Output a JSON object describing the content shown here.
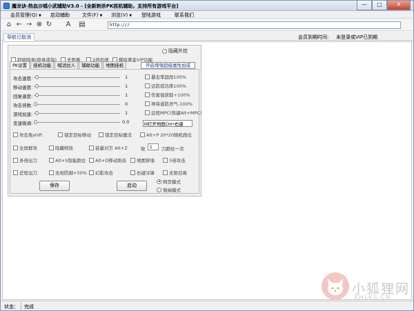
{
  "window": {
    "title": "魔龙诀-热血沙城小武辅助V3.0 - [全新刺杀PK挂机辅助，支持所有游戏平台]",
    "controls": {
      "minimize": "—",
      "maximize": "□",
      "close": "✕"
    }
  },
  "menu": [
    {
      "label": "会员管理(Q)",
      "has_arrow": true
    },
    {
      "label": "启动辅助",
      "has_arrow": false
    },
    {
      "label": "文件(F)",
      "has_arrow": true
    },
    {
      "label": "浏览(V)",
      "has_arrow": true
    },
    {
      "label": "登陆游戏",
      "has_arrow": false
    },
    {
      "label": "联系我们",
      "has_arrow": false
    }
  ],
  "toolbar": {
    "address_value": "http:///"
  },
  "tabstrip": {
    "page_tab": "导航已取消",
    "vip_label": "会员到期时间:",
    "vip_value": "未登录或VIP已到期"
  },
  "panel": {
    "top_options": [
      {
        "label": "超级隐身(隐身戒指)",
        "checked": false
      },
      {
        "label": "无限盾",
        "checked": false
      },
      {
        "label": "2倍加速",
        "checked": false
      },
      {
        "label": "模拟黄金VIP功能",
        "checked": false
      }
    ],
    "hide_plugin_label": "隐藏外挂",
    "tabs": [
      "PK设置",
      "挂机功能",
      "喊话拉人",
      "辅助功能",
      "地图挂机"
    ],
    "open_button": "开启增强超级属性加成",
    "sliders": [
      {
        "label": "攻击速度:",
        "value": "1"
      },
      {
        "label": "移动速度:",
        "value": "1"
      },
      {
        "label": "回复速度:",
        "value": "1"
      },
      {
        "label": "攻击倍数:",
        "value": "0"
      },
      {
        "label": "游戏加速:",
        "value": "1"
      },
      {
        "label": "变速微调:",
        "value": "0.0"
      }
    ],
    "right_options": [
      {
        "label": "暴击率超改100%",
        "checked": false
      },
      {
        "label": "远防成功率100%",
        "checked": false
      },
      {
        "label": "伤害值获取+100%",
        "checked": false
      },
      {
        "label": "神将道防灵气-100%",
        "checked": false
      },
      {
        "label": "远程MPC(热键Alt+MPC)",
        "checked": false
      }
    ],
    "hotkey_value": "M打开地图Ctrl+右键",
    "row1": [
      {
        "label": "攻击免shift",
        "checked": false
      },
      {
        "label": "锁定目标移动",
        "checked": false
      },
      {
        "label": "锁定目标魔法",
        "checked": false
      },
      {
        "label": "Alt+P 20*20随机跑位",
        "checked": false
      }
    ],
    "row2": [
      {
        "label": "全屏群攻",
        "checked": false
      },
      {
        "label": "隐藏特效",
        "checked": false
      },
      {
        "label": "装量对方 Alt+Z",
        "checked": false
      }
    ],
    "row2_text_a": "砍",
    "row2_num": "1",
    "row2_text_b": "刀跑位一次",
    "row3": [
      {
        "label": "多倍出刀",
        "checked": false
      },
      {
        "label": "Alt+S智能跑位",
        "checked": false
      },
      {
        "label": "Alt+D移动刺杀",
        "checked": false
      },
      {
        "label": "地图穿墙",
        "checked": false
      },
      {
        "label": "5倍攻击",
        "checked": false
      }
    ],
    "row4": [
      {
        "label": "近程出刀",
        "checked": false
      },
      {
        "label": "无视防御+50%",
        "checked": false
      },
      {
        "label": "幻影攻击",
        "checked": false
      },
      {
        "label": "右键冷锋",
        "checked": false
      },
      {
        "label": "无限召唤",
        "checked": false
      }
    ]
  },
  "buttons": {
    "save": "保存",
    "start": "启动"
  },
  "mode": [
    {
      "label": "网页模式",
      "selected": true
    },
    {
      "label": "微端模式",
      "selected": false
    }
  ],
  "watermark": {
    "cn": "小狐狸网",
    "en": "XHLKS.CN"
  },
  "status": {
    "label": "状态：",
    "value": "完成"
  }
}
